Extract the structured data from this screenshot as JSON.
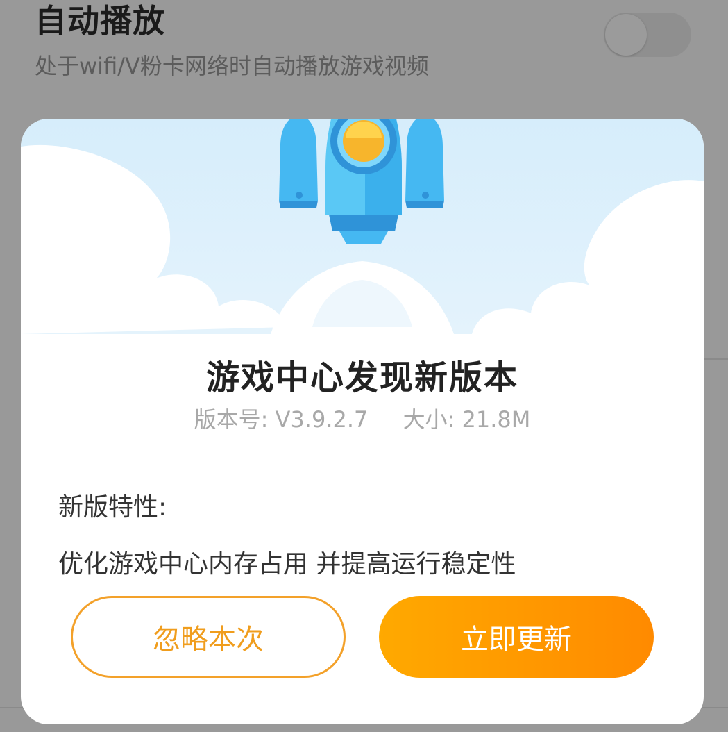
{
  "background": {
    "setting_title": "自动播放",
    "setting_desc": "处于wifi/V粉卡网络时自动播放游戏视频",
    "toggle_state": "off"
  },
  "dialog": {
    "title": "游戏中心发现新版本",
    "version_label": "版本号: V3.9.2.7",
    "size_label": "大小: 21.8M",
    "features_heading": "新版特性:",
    "features_text": "优化游戏中心内存占用 并提高运行稳定性",
    "ignore_button": "忽略本次",
    "update_button": "立即更新",
    "illustration": "rocket-icon"
  },
  "colors": {
    "accent": "#ff9a00",
    "sky": "#d8eefb",
    "overlay": "#999999"
  }
}
